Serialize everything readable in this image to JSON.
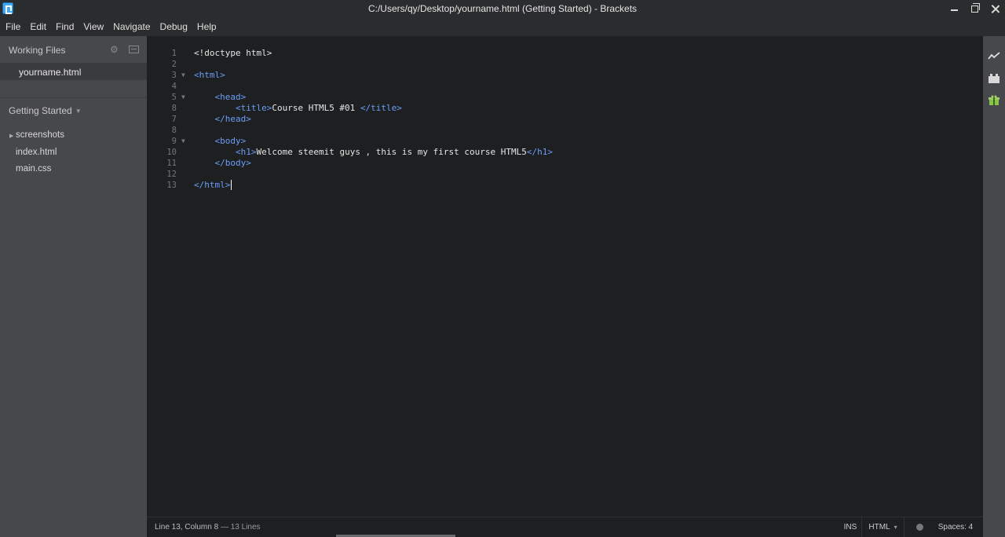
{
  "window": {
    "title": "C:/Users/qy/Desktop/yourname.html (Getting Started) - Brackets"
  },
  "menu": [
    "File",
    "Edit",
    "Find",
    "View",
    "Navigate",
    "Debug",
    "Help"
  ],
  "sidebar": {
    "working_files_label": "Working Files",
    "working_files": [
      "yourname.html"
    ],
    "project_label": "Getting Started",
    "tree": [
      {
        "label": "screenshots",
        "type": "folder"
      },
      {
        "label": "index.html",
        "type": "file"
      },
      {
        "label": "main.css",
        "type": "file"
      }
    ]
  },
  "editor": {
    "lines": [
      {
        "n": "1",
        "fold": false,
        "html": "<span class='txt'>&lt;!doctype html&gt;</span>"
      },
      {
        "n": "2",
        "fold": false,
        "html": ""
      },
      {
        "n": "3",
        "fold": true,
        "html": "<span class='tag'>&lt;html&gt;</span>"
      },
      {
        "n": "4",
        "fold": false,
        "html": ""
      },
      {
        "n": "5",
        "fold": true,
        "html": "    <span class='tag'>&lt;head&gt;</span>"
      },
      {
        "n": "8",
        "fold": false,
        "html": "        <span class='tag'>&lt;title&gt;</span><span class='txt'>Course HTML5 #01 </span><span class='tag'>&lt;/title&gt;</span>"
      },
      {
        "n": "7",
        "fold": false,
        "html": "    <span class='tag'>&lt;/head&gt;</span>"
      },
      {
        "n": "8",
        "fold": false,
        "html": ""
      },
      {
        "n": "9",
        "fold": true,
        "html": "    <span class='tag'>&lt;body&gt;</span>"
      },
      {
        "n": "10",
        "fold": false,
        "html": "        <span class='tag'>&lt;h1&gt;</span><span class='txt'>Welcome steemit guys , this is my first course HTML5</span><span class='tag'>&lt;/h1&gt;</span>"
      },
      {
        "n": "11",
        "fold": false,
        "html": "    <span class='tag'>&lt;/body&gt;</span>"
      },
      {
        "n": "12",
        "fold": false,
        "html": ""
      },
      {
        "n": "13",
        "fold": false,
        "html": "<span class='tag'>&lt;/html&gt;</span><span class='cursor'></span>"
      }
    ]
  },
  "status": {
    "position": "Line 13, Column 8",
    "line_count": " — 13 Lines",
    "mode": "INS",
    "language": "HTML",
    "language_caret": "▾",
    "spaces": "Spaces: 4"
  },
  "icons": {
    "gear": "⚙"
  }
}
